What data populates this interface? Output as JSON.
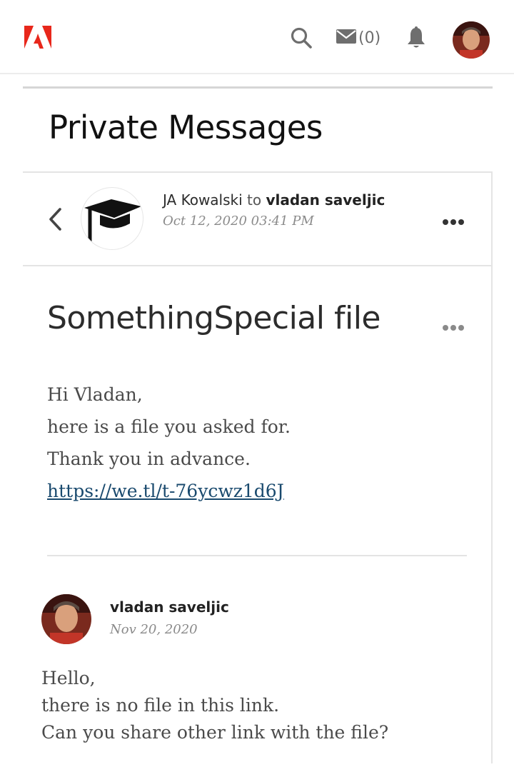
{
  "topbar": {
    "logo": "adobe-logo-icon",
    "mail_count": "(0)",
    "brand_color": "#e8271b"
  },
  "page": {
    "title": "Private Messages"
  },
  "thread": {
    "sender": "JA Kowalski",
    "to_word": "to",
    "recipient": "vladan saveljic",
    "date": "Oct 12, 2020 03:41 PM",
    "subject": "SomethingSpecial file",
    "body_lines": [
      "Hi Vladan,",
      "here is a file you asked for.",
      "Thank you in advance."
    ],
    "link_text": "https://we.tl/t-76ycwz1d6J"
  },
  "reply": {
    "author": "vladan saveljic",
    "date": "Nov 20, 2020",
    "body_lines": [
      "Hello,",
      "there is no file in this link.",
      "Can you share other link with the file?"
    ]
  }
}
